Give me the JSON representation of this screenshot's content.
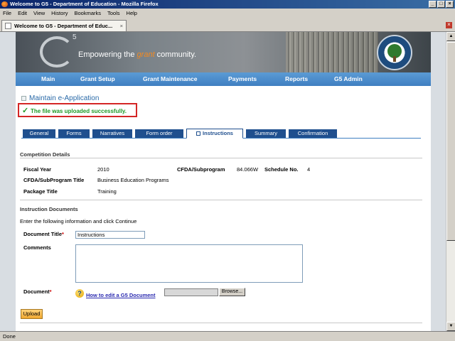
{
  "window": {
    "title": "Welcome to G5 - Department of Education - Mozilla Firefox"
  },
  "menu": [
    "File",
    "Edit",
    "View",
    "History",
    "Bookmarks",
    "Tools",
    "Help"
  ],
  "browser_tab": {
    "label": "Welcome to G5 - Department of Educ..."
  },
  "banner": {
    "logo_text": "5",
    "slogan_prefix": "Empowering the ",
    "slogan_accent": "grant",
    "slogan_suffix": " community."
  },
  "nav": [
    "Main",
    "Grant Setup",
    "Grant Maintenance",
    "Payments",
    "Reports",
    "G5 Admin"
  ],
  "page_title": "Maintain e-Application",
  "success_message": "The file was uploaded successfully.",
  "tabs": [
    "General",
    "Forms",
    "Narratives",
    "Form order",
    "Instructions",
    "Summary",
    "Confirmation"
  ],
  "active_tab": "Instructions",
  "competition": {
    "header": "Competition Details",
    "fiscal_year_label": "Fiscal Year",
    "fiscal_year": "2010",
    "cfda_label": "CFDA/Subprogram",
    "cfda": "84.066W",
    "schedule_label": "Schedule No.",
    "schedule": "4",
    "cfda_title_label": "CFDA/SubProgram Title",
    "cfda_title": "Business Education Programs",
    "package_label": "Package Title",
    "package": "Training"
  },
  "instructions": {
    "header": "Instruction Documents",
    "hint": "Enter the following information and click Continue",
    "doc_title_label": "Document Title",
    "doc_title_value": "Instructions",
    "comments_label": "Comments",
    "document_label": "Document",
    "help_link": "How to edit a G5 Document",
    "browse_label": "Browse...",
    "upload_label": "Upload"
  },
  "status": "Done",
  "colors": {
    "nav": "#3f7fc1",
    "success": "#1f9a27",
    "error_border": "#d42626",
    "tab_dark": "#1f4f8e"
  }
}
